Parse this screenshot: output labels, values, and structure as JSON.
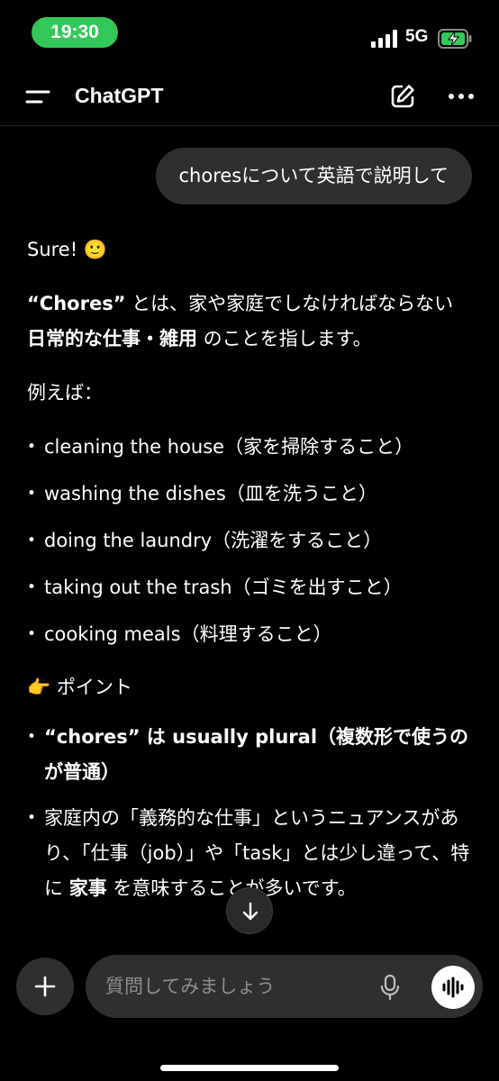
{
  "status_bar": {
    "time": "19:30",
    "network": "5G"
  },
  "header": {
    "title": "ChatGPT"
  },
  "user_message": "choresについて英語で説明して",
  "assistant": {
    "greeting": "Sure! 🙂",
    "definition_lead": "“Chores”",
    "definition_mid": " とは、家や家庭でしなければならない ",
    "definition_bold": "日常的な仕事・雑用",
    "definition_tail": " のことを指します。",
    "examples_heading": "例えば：",
    "examples": [
      "cleaning the house（家を掃除すること）",
      "washing the dishes（皿を洗うこと）",
      "doing the laundry（洗濯をすること）",
      "taking out the trash（ゴミを出すこと）",
      "cooking meals（料理すること）"
    ],
    "point_heading": "👉 ポイント",
    "point1": "“chores” は usually plural（複数形で使うのが普通）",
    "point2_a": "家庭内の「義務的な仕事」というニュアンスがあり、「仕事（job）」や「task」とは少し違って、特に ",
    "point2_bold": "家事",
    "point2_b": " を意味することが多いです。"
  },
  "composer": {
    "placeholder": "質問してみましょう"
  }
}
